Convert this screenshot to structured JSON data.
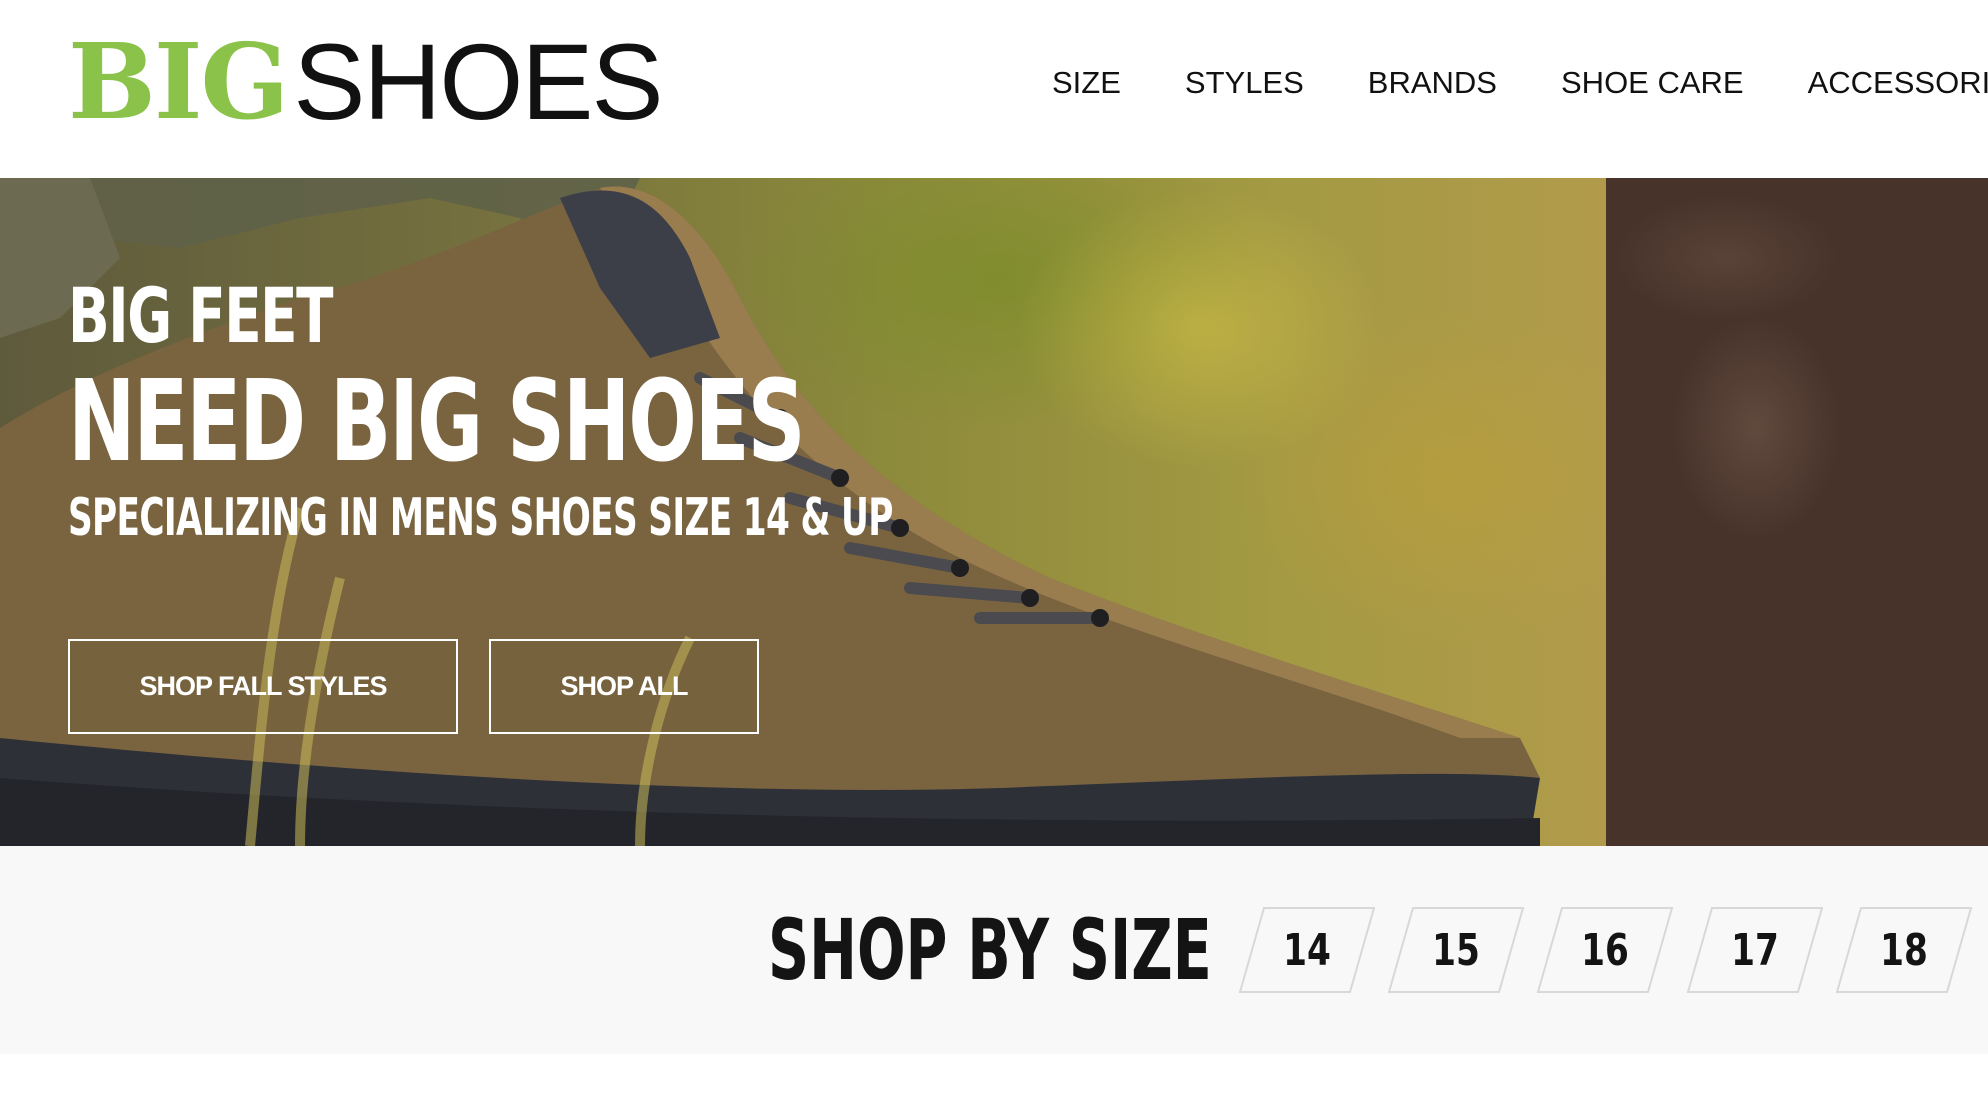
{
  "brand": {
    "logo_big": "BIG",
    "logo_shoes": "SHOES",
    "logo_big_color": "#8bc34a"
  },
  "nav": {
    "items": [
      {
        "label": "SIZE"
      },
      {
        "label": "STYLES"
      },
      {
        "label": "BRANDS"
      },
      {
        "label": "SHOE CARE"
      },
      {
        "label": "ACCESSORIES"
      }
    ]
  },
  "hero": {
    "line1": "BIG FEET",
    "line2": "NEED BIG SHOES",
    "line3": "SPECIALIZING IN MENS SHOES SIZE 14 & UP",
    "buttons": {
      "shop_fall": "SHOP FALL STYLES",
      "shop_all": "SHOP ALL"
    },
    "texture_color": "#48332b"
  },
  "shop_by_size": {
    "title": "SHOP BY SIZE",
    "sizes": [
      "14",
      "15",
      "16",
      "17",
      "18"
    ]
  }
}
